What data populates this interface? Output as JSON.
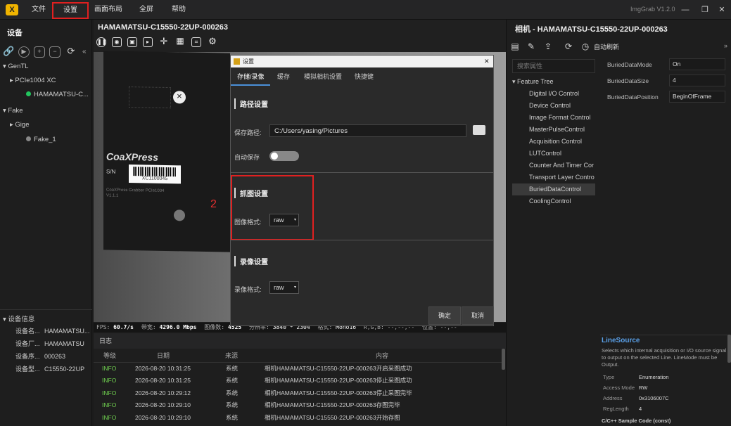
{
  "app": {
    "title": "ImgGrab V1.2.0"
  },
  "menu": {
    "file": "文件",
    "settings": "设置",
    "layout": "画面布局",
    "fullscreen": "全屏",
    "help": "帮助"
  },
  "window": {
    "minimize": "—",
    "restore": "❐",
    "close": "✕"
  },
  "left": {
    "title": "设备",
    "tree": [
      "GenTL",
      "PCIe1004 XC",
      "HAMAMATSU-C...",
      "Fake",
      "Gige",
      "Fake_1"
    ],
    "info_title": "设备信息",
    "info": [
      {
        "k": "设备名...",
        "v": "HAMAMATSU..."
      },
      {
        "k": "设备厂...",
        "v": "HAMAMATSU"
      },
      {
        "k": "设备序...",
        "v": "000263"
      },
      {
        "k": "设备型...",
        "v": "C15550-22UP"
      }
    ]
  },
  "camera": {
    "title": "HAMAMATSU-C15550-22UP-000263",
    "status": {
      "fps_label": "FPS:",
      "fps": "60.7/s",
      "bw_label": "带宽:",
      "bw": "4296.0 Mbps",
      "frames_label": "图像数:",
      "frames": "4525",
      "res_label": "分辨率:",
      "res": "3840 * 2304",
      "fmt_label": "格式:",
      "fmt": "Mono16",
      "rgb_label": "R,G,B:",
      "rgb": "--,--,--",
      "pos_label": "位置:",
      "pos": "--,--"
    },
    "image_text": {
      "brand": "CoaXPress",
      "sn": "S/N",
      "label": "XC1100045",
      "board": "CoaXPress Grabber PCIe1004",
      "ver": "V1.1.1"
    }
  },
  "dialog": {
    "title": "设置",
    "close": "✕",
    "tabs": [
      "存储/录像",
      "缓存",
      "模拟相机设置",
      "快捷键"
    ],
    "path_section": "路径设置",
    "save_path_label": "保存路径:",
    "save_path": "C:/Users/yasing/Pictures",
    "auto_save_label": "自动保存",
    "grab_section": "抓图设置",
    "image_format_label": "图像格式:",
    "image_format": "raw",
    "record_section": "录像设置",
    "record_format_label": "录像格式:",
    "record_format": "raw",
    "ok": "确定",
    "cancel": "取消",
    "annotation": "2"
  },
  "log": {
    "title": "日志",
    "columns": [
      "等级",
      "日期",
      "来源",
      "内容"
    ],
    "rows": [
      {
        "level": "INFO",
        "date": "2026-08-20 10:31:25",
        "source": "系统",
        "content": "相机HAMAMATSU-C15550-22UP-000263开启采图成功"
      },
      {
        "level": "INFO",
        "date": "2026-08-20 10:31:25",
        "source": "系统",
        "content": "相机HAMAMATSU-C15550-22UP-000263停止采图成功"
      },
      {
        "level": "INFO",
        "date": "2026-08-20 10:29:12",
        "source": "系统",
        "content": "相机HAMAMATSU-C15550-22UP-000263停止采图完毕"
      },
      {
        "level": "INFO",
        "date": "2026-08-20 10:29:10",
        "source": "系统",
        "content": "相机HAMAMATSU-C15550-22UP-000263存图完毕"
      },
      {
        "level": "INFO",
        "date": "2026-08-20 10:29:10",
        "source": "系统",
        "content": "相机HAMAMATSU-C15550-22UP-000263开始存图"
      }
    ]
  },
  "right": {
    "title": "相机 - HAMAMATSU-C15550-22UP-000263",
    "auto_refresh": "自动刷新",
    "search_placeholder": "搜索属性",
    "tree_root": "Feature Tree",
    "tree": [
      "Digital I/O Control",
      "Device Control",
      "Image Format Control",
      "MasterPulseControl",
      "Acquisition Control",
      "LUTControl",
      "Counter And Timer Cor",
      "Transport Layer Contro",
      "BuriedDataControl",
      "CoolingControl"
    ],
    "props": [
      {
        "k": "BuriedDataMode",
        "v": "On"
      },
      {
        "k": "BuriedDataSize",
        "v": "4"
      },
      {
        "k": "BuriedDataPosition",
        "v": "BeginOfFrame"
      }
    ],
    "desc": {
      "title": "LineSource",
      "text": "Selects which internal acquisition or I/O source signal to output on the selected Line. LineMode must be Output.",
      "rows": [
        {
          "k": "Type",
          "v": "Enumeration"
        },
        {
          "k": "Access Mode",
          "v": "RW"
        },
        {
          "k": "Address",
          "v": "0x3106007C"
        },
        {
          "k": "RegLength",
          "v": "4"
        }
      ],
      "more": "C/C++ Sample Code (const) "
    }
  }
}
